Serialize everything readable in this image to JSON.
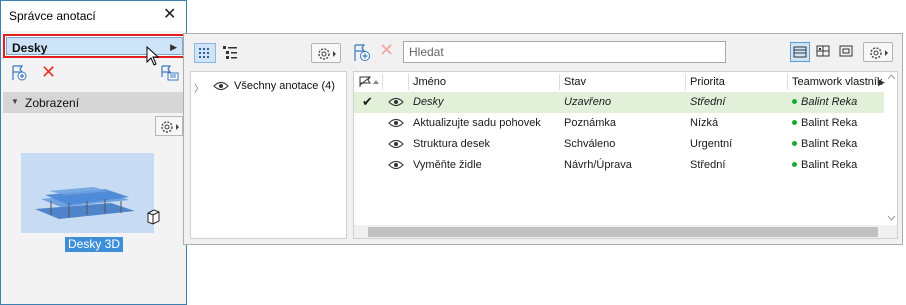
{
  "palette": {
    "title": "Správce anotací",
    "dropdown_value": "Desky",
    "view_section_label": "Zobrazení",
    "thumbnail_caption": "Desky 3D"
  },
  "tree": {
    "root_label": "Všechny anotace (4)"
  },
  "search": {
    "placeholder": "Hledat"
  },
  "table": {
    "columns": [
      "Jméno",
      "Stav",
      "Priorita",
      "Teamwork vlastník"
    ],
    "rows": [
      {
        "name": "Desky",
        "status": "Uzavřeno",
        "priority": "Střední",
        "owner": "Balint Reka",
        "closed": true,
        "selected": true
      },
      {
        "name": "Aktualizujte sadu pohovek",
        "status": "Poznámka",
        "priority": "Nízká",
        "owner": "Balint Reka",
        "closed": false,
        "selected": false
      },
      {
        "name": "Struktura desek",
        "status": "Schváleno",
        "priority": "Urgentní",
        "owner": "Balint Reka",
        "closed": false,
        "selected": false
      },
      {
        "name": "Vyměňte židle",
        "status": "Návrh/Úprava",
        "priority": "Střední",
        "owner": "Balint Reka",
        "closed": false,
        "selected": false
      }
    ]
  },
  "colors": {
    "selection_row": "#e2f0da",
    "dropdown_highlight_border": "#e02020",
    "delete_icon": "#e8352a",
    "owner_online_dot": "#1aa832",
    "accent_blue": "#3f8fd8"
  },
  "icons": [
    "close-icon",
    "add-annotation-icon",
    "delete-icon",
    "select-elements-icon",
    "gear-icon",
    "tree-view-icon",
    "list-view-icon",
    "eye-icon",
    "checkmark-icon",
    "table-view-icon",
    "card-view-icon",
    "single-view-icon",
    "3d-cube-icon",
    "chevron-right-icon"
  ]
}
